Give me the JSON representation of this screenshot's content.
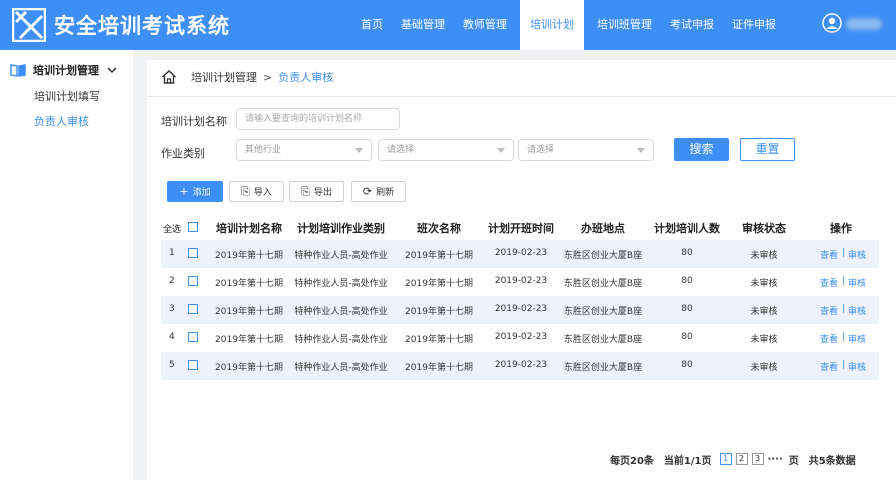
{
  "app": {
    "title": "安全培训考试系统"
  },
  "nav": [
    {
      "label": "首页",
      "active": false
    },
    {
      "label": "基础管理",
      "active": false
    },
    {
      "label": "教师管理",
      "active": false
    },
    {
      "label": "培训计划",
      "active": true
    },
    {
      "label": "培训班管理",
      "active": false
    },
    {
      "label": "考试申报",
      "active": false
    },
    {
      "label": "证件申报",
      "active": false
    }
  ],
  "sidebar": {
    "group": "培训计划管理",
    "items": [
      {
        "label": "培训计划填写",
        "active": false
      },
      {
        "label": "负责人审核",
        "active": true
      }
    ]
  },
  "breadcrumb": {
    "parent": "培训计划管理",
    "sep": ">",
    "current": "负责人审核"
  },
  "filters": {
    "name_label": "培训计划名称",
    "name_placeholder": "请输入要查询的培训计划名称",
    "type_label": "作业类别",
    "select1": "其他行业",
    "select2": "请选择",
    "select3": "请选择",
    "search": "搜索",
    "reset": "重置"
  },
  "toolbar": {
    "add": "添加",
    "import": "导入",
    "export": "导出",
    "refresh": "刷新"
  },
  "table": {
    "select_all": "全选",
    "headers": [
      "培训计划名称",
      "计划培训作业类别",
      "班次名称",
      "计划开班时间",
      "办班地点",
      "计划培训人数",
      "审核状态",
      "操作"
    ],
    "rows": [
      {
        "no": "1",
        "name": "2019年第十七期",
        "type": "特种作业人员-高处作业",
        "class": "2019年第十七期",
        "date": "2019-02-23",
        "place": "东胜区创业大厦B座",
        "count": "80",
        "status": "未审核",
        "view": "查看",
        "sep": "|",
        "audit": "审核"
      },
      {
        "no": "2",
        "name": "2019年第十七期",
        "type": "特种作业人员-高处作业",
        "class": "2019年第十七期",
        "date": "2019-02-23",
        "place": "东胜区创业大厦B座",
        "count": "80",
        "status": "未审核",
        "view": "查看",
        "sep": "|",
        "audit": "审核"
      },
      {
        "no": "3",
        "name": "2019年第十七期",
        "type": "特种作业人员-高处作业",
        "class": "2019年第十七期",
        "date": "2019-02-23",
        "place": "东胜区创业大厦B座",
        "count": "80",
        "status": "未审核",
        "view": "查看",
        "sep": "|",
        "audit": "审核"
      },
      {
        "no": "4",
        "name": "2019年第十七期",
        "type": "特种作业人员-高处作业",
        "class": "2019年第十七期",
        "date": "2019-02-23",
        "place": "东胜区创业大厦B座",
        "count": "80",
        "status": "未审核",
        "view": "查看",
        "sep": "|",
        "audit": "审核"
      },
      {
        "no": "5",
        "name": "2019年第十七期",
        "type": "特种作业人员-高处作业",
        "class": "2019年第十七期",
        "date": "2019-02-23",
        "place": "东胜区创业大厦B座",
        "count": "80",
        "status": "未审核",
        "view": "查看",
        "sep": "|",
        "audit": "审核"
      }
    ]
  },
  "pagination": {
    "per_page": "每页20条",
    "current": "当前1/1页",
    "pages": [
      "1",
      "2",
      "3"
    ],
    "ellipsis": "····",
    "page_unit": "页",
    "total": "共5条数据"
  },
  "colors": {
    "primary": "#3d8ef5",
    "row_alt": "#edf2fc"
  }
}
